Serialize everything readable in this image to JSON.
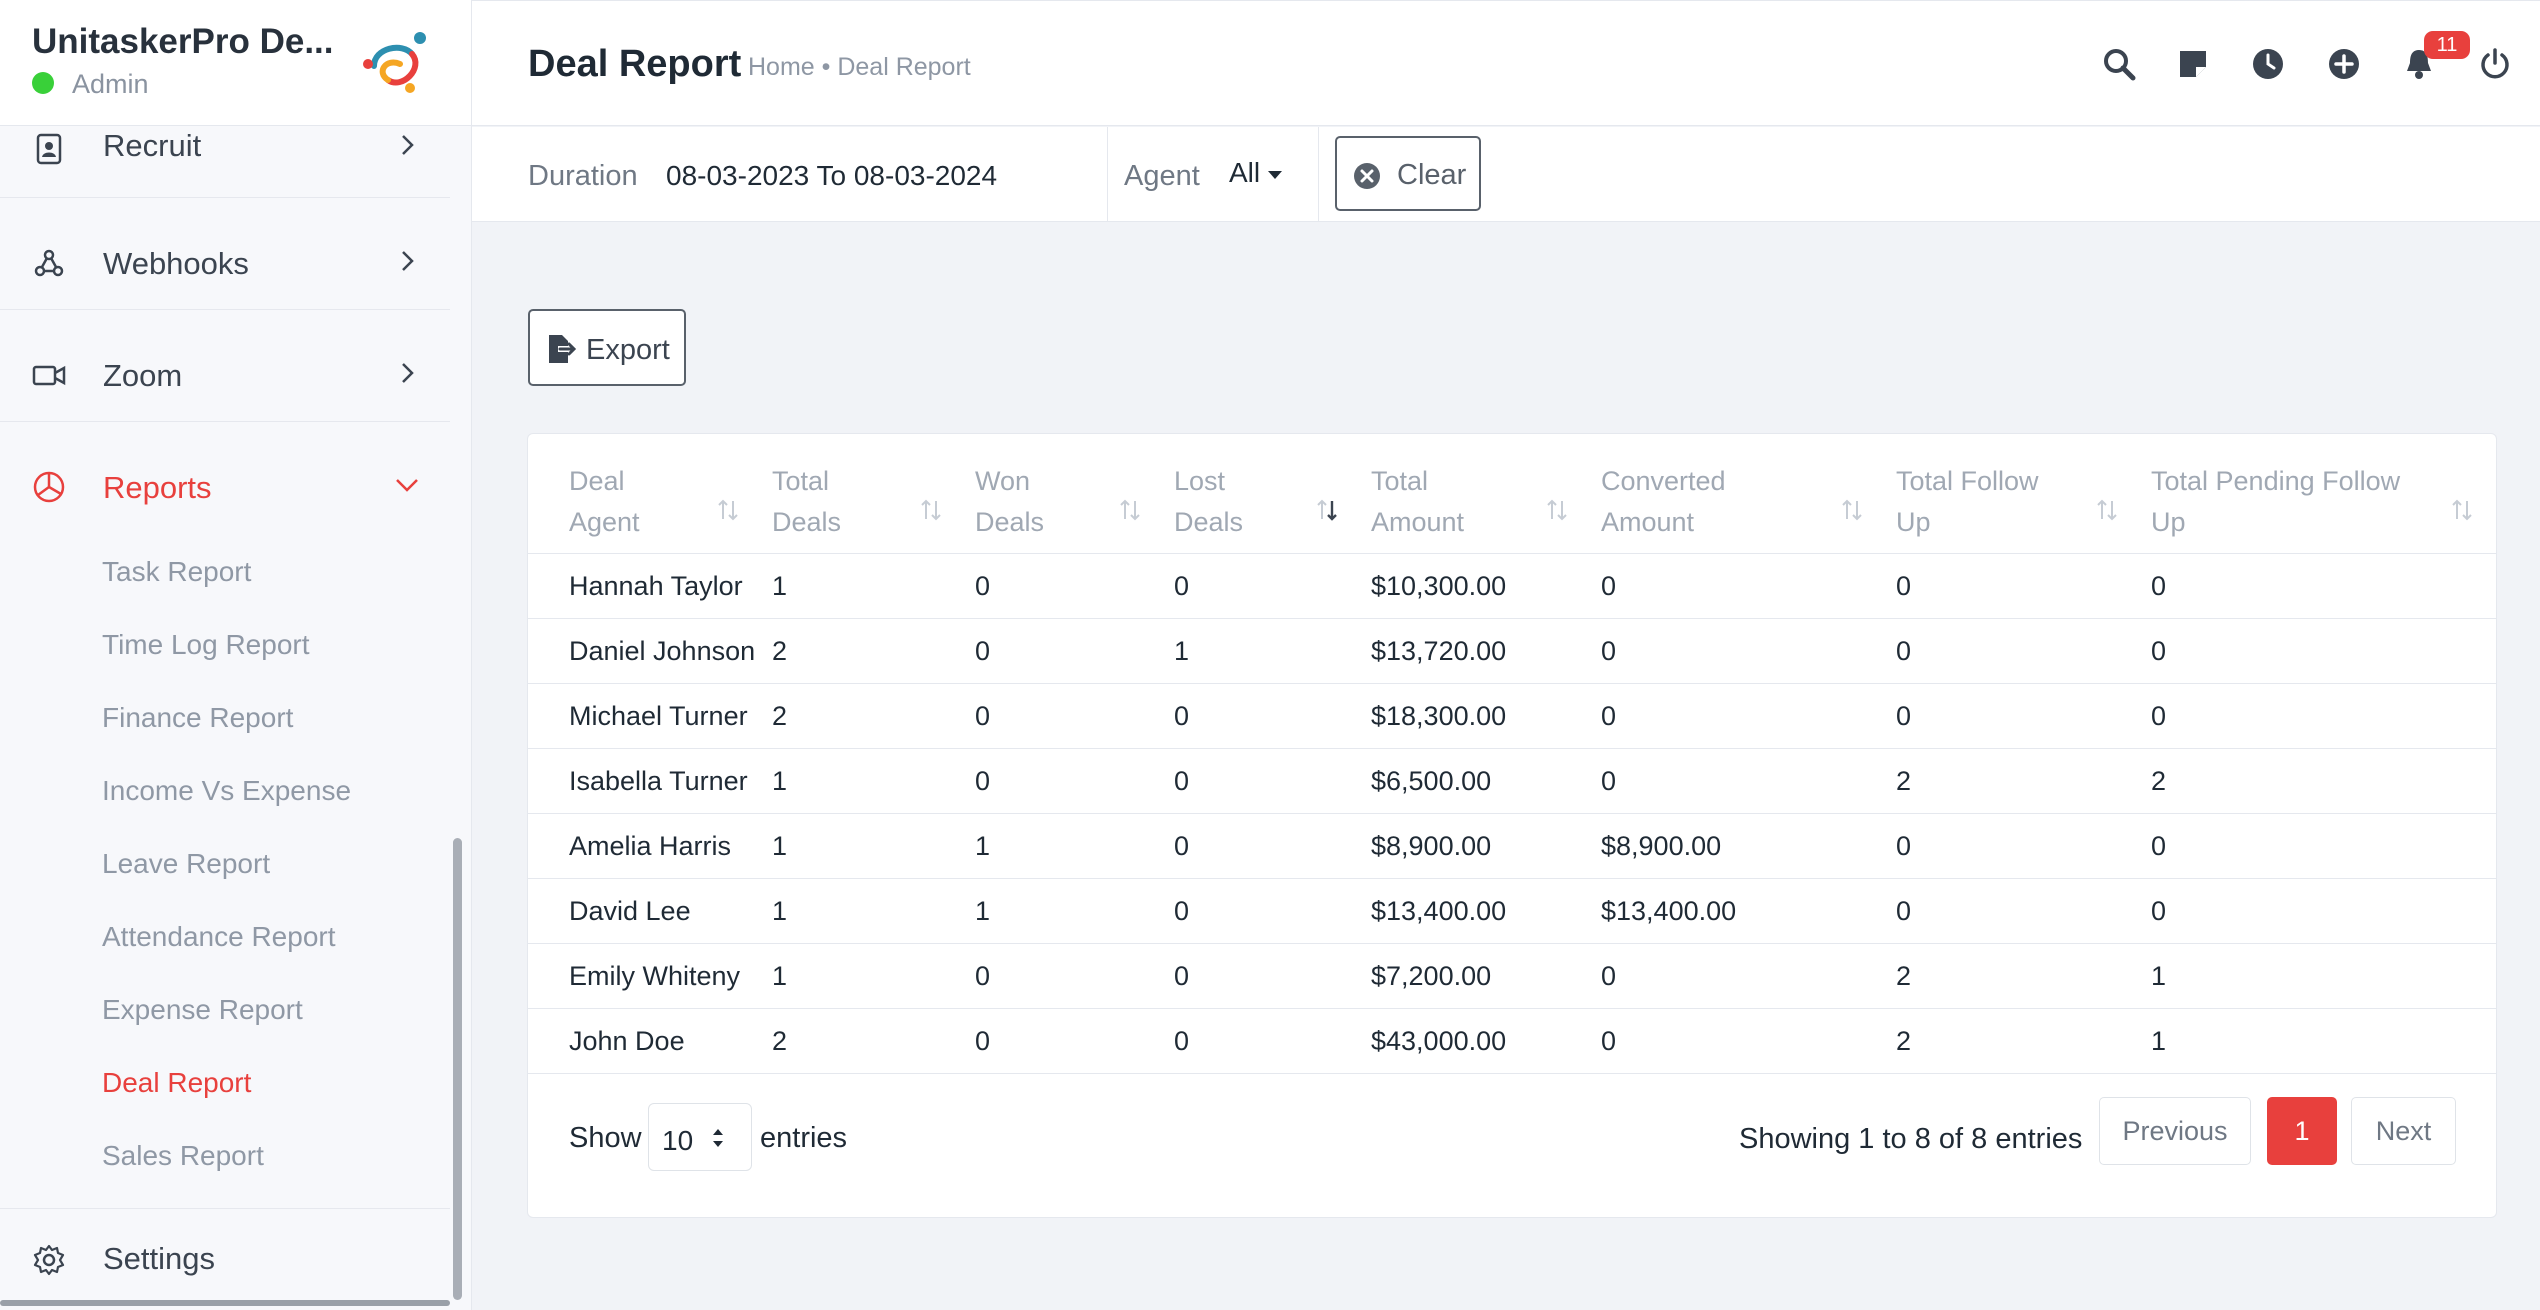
{
  "sidebar": {
    "brand_name": "UnitaskerPro De...",
    "role": "Admin",
    "menu": [
      {
        "label": "Recruit"
      },
      {
        "label": "Webhooks"
      },
      {
        "label": "Zoom"
      },
      {
        "label": "Reports"
      }
    ],
    "reports_submenu": [
      "Task Report",
      "Time Log Report",
      "Finance Report",
      "Income Vs Expense",
      "Leave Report",
      "Attendance Report",
      "Expense Report",
      "Deal Report",
      "Sales Report"
    ],
    "settings_label": "Settings",
    "active_color": "#e8403d"
  },
  "header": {
    "title": "Deal Report",
    "breadcrumb": "Home • Deal Report",
    "icons": [
      "search-icon",
      "sticky-note-icon",
      "clock-icon",
      "plus-circle-icon",
      "bell-icon",
      "power-icon"
    ],
    "notification_count": "11"
  },
  "filters": {
    "duration_label": "Duration",
    "duration_value": "08-03-2023 To 08-03-2024",
    "agent_label": "Agent",
    "agent_value": "All",
    "clear_label": "Clear"
  },
  "export_label": "Export",
  "table": {
    "columns": [
      [
        "Deal",
        "Agent"
      ],
      [
        "Total",
        "Deals"
      ],
      [
        "Won",
        "Deals"
      ],
      [
        "Lost",
        "Deals"
      ],
      [
        "Total",
        "Amount"
      ],
      [
        "Converted",
        "Amount"
      ],
      [
        "Total Follow",
        "Up"
      ],
      [
        "Total Pending Follow",
        "Up"
      ]
    ],
    "rows": [
      [
        "Hannah Taylor",
        "1",
        "0",
        "0",
        "$10,300.00",
        "0",
        "0",
        "0"
      ],
      [
        "Daniel Johnson",
        "2",
        "0",
        "1",
        "$13,720.00",
        "0",
        "0",
        "0"
      ],
      [
        "Michael Turner",
        "2",
        "0",
        "0",
        "$18,300.00",
        "0",
        "0",
        "0"
      ],
      [
        "Isabella Turner",
        "1",
        "0",
        "0",
        "$6,500.00",
        "0",
        "2",
        "2"
      ],
      [
        "Amelia Harris",
        "1",
        "1",
        "0",
        "$8,900.00",
        "$8,900.00",
        "0",
        "0"
      ],
      [
        "David Lee",
        "1",
        "1",
        "0",
        "$13,400.00",
        "$13,400.00",
        "0",
        "0"
      ],
      [
        "Emily Whiteny",
        "1",
        "0",
        "0",
        "$7,200.00",
        "0",
        "2",
        "1"
      ],
      [
        "John Doe",
        "2",
        "0",
        "0",
        "$43,000.00",
        "0",
        "2",
        "1"
      ]
    ]
  },
  "footer": {
    "show_label": "Show",
    "entries_value": "10",
    "entries_label": "entries",
    "showing_text": "Showing 1 to 8 of 8 entries",
    "prev_label": "Previous",
    "page": "1",
    "next_label": "Next"
  }
}
